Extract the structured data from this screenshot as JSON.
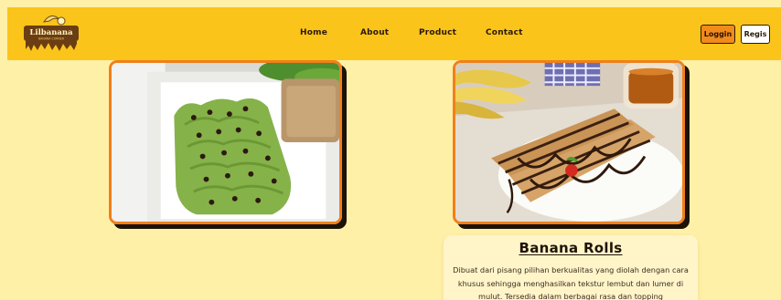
{
  "nav": {
    "logo_text": "Lilbanana",
    "logo_tagline": "BANANA CORNER",
    "links": [
      "Home",
      "About",
      "Product",
      "Contact"
    ],
    "login_label": "Loggin",
    "register_label": "Regis"
  },
  "product": {
    "title": "Banana Rolls",
    "description": "Dibuat dari pisang pilihan berkualitas yang diolah dengan cara khusus sehingga menghasilkan tekstur lembut dan lumer di mulut. Tersedia dalam berbagai rasa dan topping"
  },
  "colors": {
    "page_bg": "#fff0a8",
    "navbar_bg": "#fbc41b",
    "accent_orange": "#f08b1c"
  }
}
